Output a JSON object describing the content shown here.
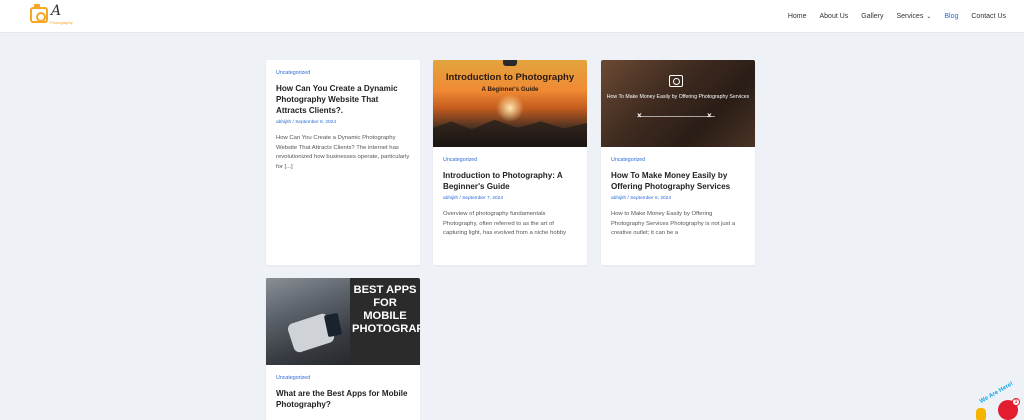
{
  "logo": {
    "mark": "A",
    "sub": "Photography"
  },
  "nav": [
    {
      "label": "Home"
    },
    {
      "label": "About Us"
    },
    {
      "label": "Gallery"
    },
    {
      "label": "Services"
    },
    {
      "label": "Blog"
    },
    {
      "label": "Contact Us"
    }
  ],
  "posts": [
    {
      "category": "Uncategorized",
      "title": "How Can You Create a Dynamic Photography Website That Attracts Clients?.",
      "meta": "abhijith / September 8, 2024",
      "excerpt": "How Can You Create a Dynamic Photography Website That Attracts Clients? The internet has revolutionized how businesses operate, particularly for [...]"
    },
    {
      "category": "Uncategorized",
      "title": "Introduction to Photography: A Beginner's Guide",
      "meta": "abhijith / September 7, 2024",
      "excerpt": "Overview of photography fundamentals Photography, often referred to as the art of capturing light, has evolved from a niche hobby",
      "thumb_title": "Introduction to Photography",
      "thumb_sub": "A Beginner's Guide"
    },
    {
      "category": "Uncategorized",
      "title": "How To Make Money Easily by Offering Photography Services",
      "meta": "abhijith / September 6, 2024",
      "excerpt": "How to Make Money Easily by Offering Photography Services Photography is not just a creative outlet; it can be a",
      "thumb_caption": "How To Make Money Easily by Offering Photography Services"
    },
    {
      "category": "Uncategorized",
      "title": "What are the Best Apps for Mobile Photography?",
      "thumb_text": "BEST APPS FOR MOBILE PHOTOGRAPHY"
    }
  ],
  "chat_badge": {
    "text": "We Are Here!",
    "count": "1"
  },
  "colors": {
    "accent": "#2a6ad6",
    "background": "#eef2f7",
    "logo": "#f5a623"
  }
}
